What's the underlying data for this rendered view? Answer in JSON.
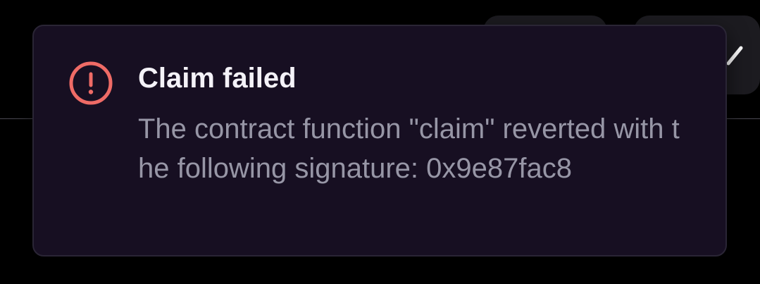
{
  "toast": {
    "title": "Claim failed",
    "message": "The contract function \"claim\" reverted with the following signature: 0x9e87fac8",
    "icon": "alert-circle-icon",
    "colors": {
      "background": "#170f22",
      "border": "#2a2535",
      "icon": "#ef6b66",
      "title": "#f4f2f8",
      "message": "#9796a6"
    }
  },
  "background": {
    "icons": [
      "pencil-icon"
    ]
  }
}
